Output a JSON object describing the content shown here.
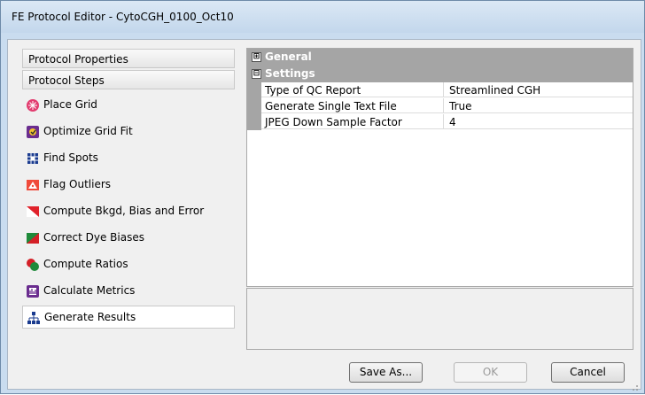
{
  "window": {
    "title": "FE Protocol Editor - CytoCGH_0100_Oct10"
  },
  "left_pane": {
    "protocol_properties_label": "Protocol Properties",
    "protocol_steps_label": "Protocol Steps",
    "steps": [
      {
        "label": "Place Grid",
        "icon": "place-grid-icon"
      },
      {
        "label": "Optimize Grid Fit",
        "icon": "optimize-grid-fit-icon"
      },
      {
        "label": "Find Spots",
        "icon": "find-spots-icon"
      },
      {
        "label": "Flag Outliers",
        "icon": "flag-outliers-icon"
      },
      {
        "label": "Compute Bkgd, Bias and Error",
        "icon": "compute-bkgd-icon"
      },
      {
        "label": "Correct Dye Biases",
        "icon": "correct-dye-biases-icon"
      },
      {
        "label": "Compute Ratios",
        "icon": "compute-ratios-icon"
      },
      {
        "label": "Calculate Metrics",
        "icon": "calculate-metrics-icon"
      },
      {
        "label": "Generate Results",
        "icon": "generate-results-icon",
        "selected": true
      }
    ]
  },
  "property_grid": {
    "categories": [
      {
        "label": "General",
        "expanded": false,
        "expander": "⊞"
      },
      {
        "label": "Settings",
        "expanded": true,
        "expander": "⊟"
      }
    ],
    "rows": [
      {
        "name": "Type of QC Report",
        "value": "Streamlined CGH"
      },
      {
        "name": "Generate Single Text File",
        "value": "True"
      },
      {
        "name": "JPEG Down Sample Factor",
        "value": "4"
      }
    ]
  },
  "buttons": {
    "save_as": "Save As...",
    "ok": "OK",
    "cancel": "Cancel"
  },
  "colors": {
    "category_bg": "#a5a5a5",
    "window_frame": "#c9dcef"
  }
}
